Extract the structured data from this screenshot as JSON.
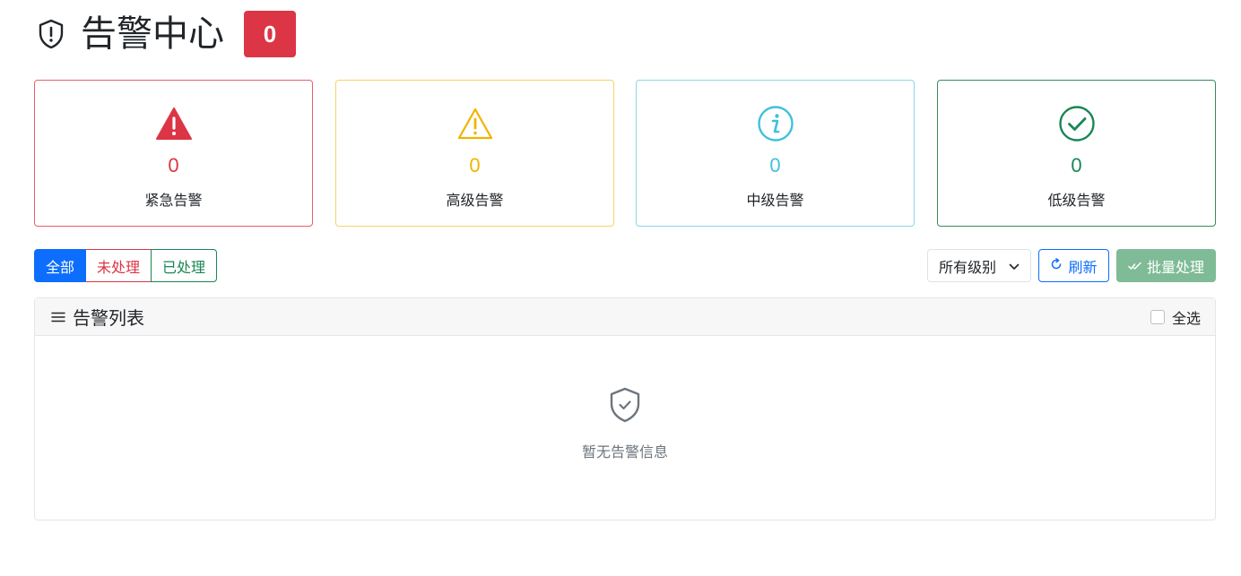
{
  "header": {
    "title": "告警中心",
    "alert_count": "0"
  },
  "summary": {
    "urgent": {
      "value": "0",
      "label": "紧急告警",
      "color": "#dc3545",
      "icon": "warning-filled-icon"
    },
    "high": {
      "value": "0",
      "label": "高级告警",
      "color": "#f0b400",
      "icon": "warning-outline-icon"
    },
    "mid": {
      "value": "0",
      "label": "中级告警",
      "color": "#3fc1dc",
      "icon": "info-circle-icon"
    },
    "low": {
      "value": "0",
      "label": "低级告警",
      "color": "#198754",
      "icon": "check-circle-icon"
    }
  },
  "filters": {
    "all": "全部",
    "pending": "未处理",
    "done": "已处理"
  },
  "toolbar": {
    "level_select": "所有级别",
    "refresh": "刷新",
    "batch": "批量处理"
  },
  "list": {
    "title": "告警列表",
    "select_all": "全选",
    "empty_text": "暂无告警信息"
  }
}
